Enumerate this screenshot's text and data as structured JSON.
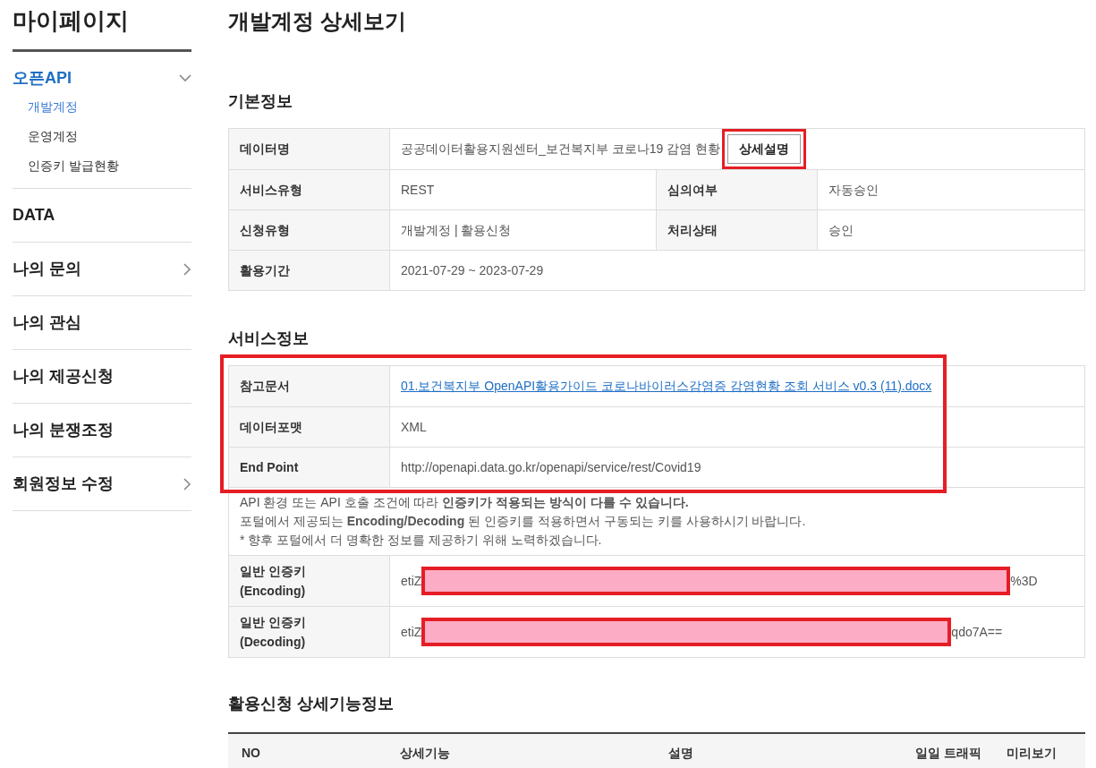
{
  "sidebar": {
    "title": "마이페이지",
    "groups": [
      {
        "label": "오픈API",
        "selected": true,
        "expanded": true,
        "kind": "expandable",
        "children": [
          {
            "label": "개발계정",
            "selected": true
          },
          {
            "label": "운영계정",
            "selected": false
          },
          {
            "label": "인증키 발급현황",
            "selected": false
          }
        ]
      },
      {
        "label": "DATA",
        "selected": false,
        "kind": "plain"
      },
      {
        "label": "나의 문의",
        "selected": false,
        "expanded": false,
        "kind": "expandable"
      },
      {
        "label": "나의 관심",
        "selected": false,
        "kind": "plain"
      },
      {
        "label": "나의 제공신청",
        "selected": false,
        "kind": "plain"
      },
      {
        "label": "나의 분쟁조정",
        "selected": false,
        "kind": "plain"
      },
      {
        "label": "회원정보 수정",
        "selected": false,
        "expanded": false,
        "kind": "expandable"
      }
    ]
  },
  "page_title": "개발계정 상세보기",
  "basic_info": {
    "heading": "기본정보",
    "data_name": {
      "label": "데이터명",
      "value": "공공데이터활용지원센터_보건복지부 코로나19 감염 현황",
      "button": "상세설명",
      "highlighted": true
    },
    "rows": [
      [
        {
          "label": "서비스유형",
          "value": "REST"
        },
        {
          "label": "심의여부",
          "value": "자동승인"
        }
      ],
      [
        {
          "label": "신청유형",
          "value": "개발계정 | 활용신청"
        },
        {
          "label": "처리상태",
          "value": "승인"
        }
      ],
      [
        {
          "label": "활용기간",
          "value": "2021-07-29 ~ 2023-07-29"
        }
      ]
    ]
  },
  "service_info": {
    "heading": "서비스정보",
    "highlighted": true,
    "rows": [
      {
        "label": "참고문서",
        "value": "01.보건복지부 OpenAPI활용가이드 코로나바이러스감염증 감염현황 조회 서비스 v0.3 (11).docx",
        "kind": "link"
      },
      {
        "label": "데이터포맷",
        "value": "XML",
        "kind": "text"
      },
      {
        "label": "End Point",
        "value": "http://openapi.data.go.kr/openapi/service/rest/Covid19",
        "kind": "text"
      }
    ],
    "notice": [
      "API 환경 또는 API 호출 조건에 따라 **인증키가 적용되는 방식이 다를 수 있습니다.**",
      "포털에서 제공되는 **Encoding/Decoding** 된 인증키를 적용하면서 구동되는 키를 사용하시기 바랍니다.",
      "* 향후 포털에서 더 명확한 정보를 제공하기 위해 노력하겠습니다."
    ],
    "keys": [
      {
        "label": "일반 인증키",
        "sub": "(Encoding)",
        "value_start": "etiZ",
        "value_end": "%3D",
        "redacted": true
      },
      {
        "label": "일반 인증키",
        "sub": "(Decoding)",
        "value_start": "etiZ",
        "value_end": "qdo7A==",
        "redacted": true
      }
    ]
  },
  "detail": {
    "heading": "활용신청 상세기능정보",
    "columns": [
      "NO",
      "상세기능",
      "설명",
      "일일 트래픽",
      "미리보기"
    ]
  }
}
